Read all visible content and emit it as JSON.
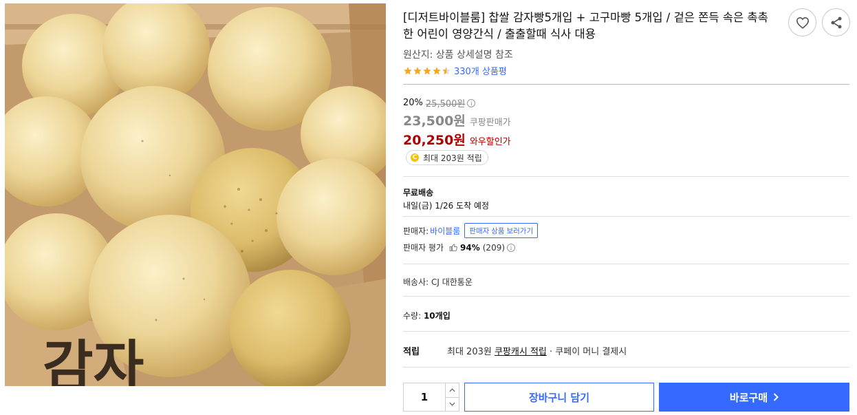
{
  "product": {
    "title": "[디저트바이블룸] 찹쌀 감자빵5개입 + 고구마빵 5개입 / 겉은 쫀득 속은 촉촉한 어린이 영양간식 / 출출할때 식사 대용",
    "image_icon": "product-photo-potato-bread",
    "box_text": "감자",
    "origin": "원산지: 상품 상세설명 참조",
    "rating_stars": 4.5,
    "review_link": "330개 상품평"
  },
  "actions": {
    "wish_icon": "heart-icon",
    "share_icon": "share-icon"
  },
  "price": {
    "discount_rate": "20%",
    "original_price": "25,500원",
    "info_icon": "i",
    "sale_price": "23,500원",
    "sale_label": "쿠팡판매가",
    "wow_price": "20,250원",
    "wow_label": "와우할인가",
    "cash_icon": "C",
    "cash_text": "최대 203원 적립"
  },
  "delivery": {
    "title": "무료배송",
    "date": "내일(금) 1/26 도착 예정"
  },
  "seller": {
    "label": "판매자:",
    "name": "바이블룸",
    "more_button": "판매자 상품 보러가기",
    "rating_label": "판매자 평가",
    "rating_pct": "94%",
    "rating_count": "(209)",
    "carrier": "배송사: CJ 대한통운"
  },
  "quantity": {
    "label": "수량:",
    "value_text": "10개입",
    "input_value": "1"
  },
  "points": {
    "title": "적립",
    "prefix": "최대 203원 ",
    "link": "쿠팡캐시 적립",
    "suffix": " · 쿠페이 머니 결제시"
  },
  "buttons": {
    "cart": "장바구니 담기",
    "buy": "바로구매"
  },
  "colors": {
    "accent": "#346aff",
    "wow_red": "#ae0000",
    "star": "#f5a623",
    "coin": "#f7c300"
  }
}
